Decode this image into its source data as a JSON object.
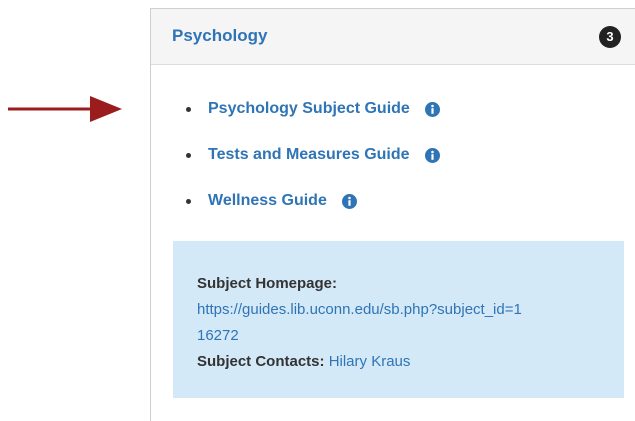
{
  "panel": {
    "title": "Psychology",
    "count_badge": "3"
  },
  "guides": [
    {
      "label": "Psychology Subject Guide",
      "icon": "info-icon"
    },
    {
      "label": "Tests and Measures Guide",
      "icon": "info-icon"
    },
    {
      "label": "Wellness Guide",
      "icon": "info-icon"
    }
  ],
  "subject_box": {
    "homepage_label": "Subject Homepage:",
    "homepage_url": "https://guides.lib.uconn.edu/sb.php?subject_id=116272",
    "contacts_label": "Subject Contacts:",
    "contact_name": "Hilary Kraus"
  },
  "colors": {
    "link": "#2f74b5",
    "arrow": "#9b1c1c",
    "info_box_bg": "#d4e9f7",
    "badge_bg": "#222222"
  }
}
